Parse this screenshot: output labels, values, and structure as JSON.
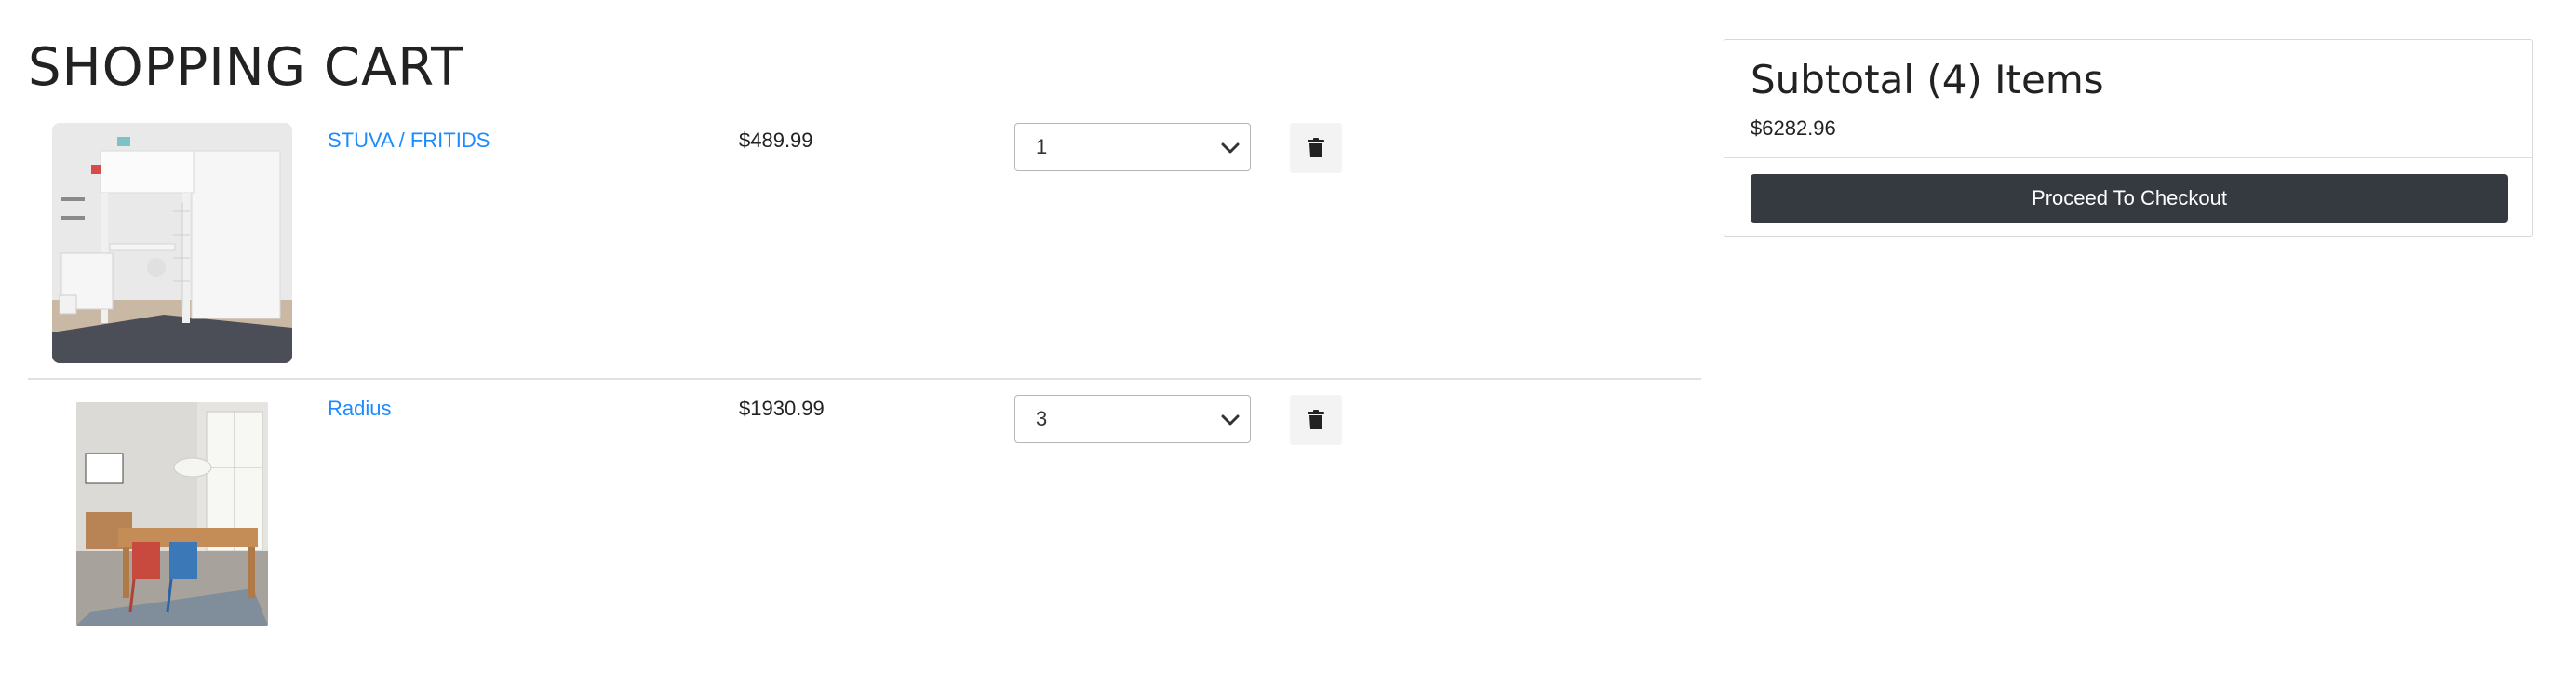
{
  "page": {
    "title": "SHOPPING CART"
  },
  "cart": {
    "items": [
      {
        "name": "STUVA / FRITIDS",
        "price": "$489.99",
        "quantity": "1",
        "image": "loft-bed-desk-photo",
        "delete_icon": "trash-icon"
      },
      {
        "name": "Radius",
        "price": "$1930.99",
        "quantity": "3",
        "image": "dining-room-table-photo",
        "delete_icon": "trash-icon"
      }
    ]
  },
  "summary": {
    "title": "Subtotal (4) Items",
    "total": "$6282.96",
    "checkout_label": "Proceed To Checkout"
  },
  "colors": {
    "link": "#1a8cff",
    "checkout_button": "#343a40",
    "delete_button_bg": "#f3f3f3"
  }
}
